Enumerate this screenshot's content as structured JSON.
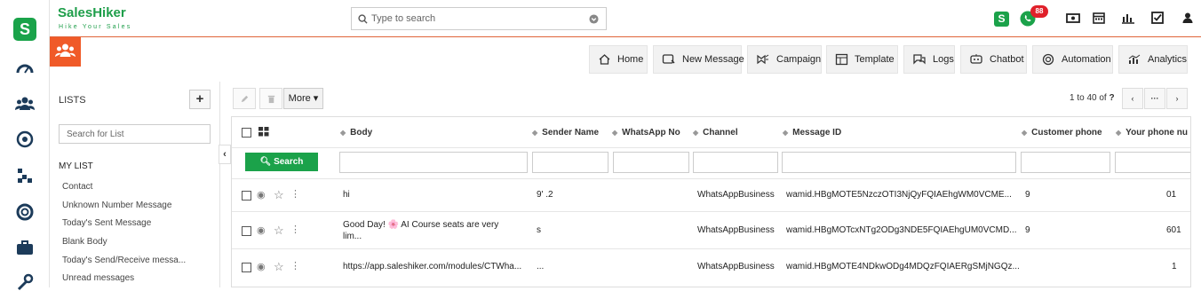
{
  "app": {
    "brand_name": "SalesHiker",
    "tagline": "Hike Your Sales",
    "whatsapp_badge": "88"
  },
  "search": {
    "placeholder": "Type to search"
  },
  "nav": [
    {
      "label": "Home",
      "icon": "home-icon"
    },
    {
      "label": "New Message",
      "icon": "new-message-icon"
    },
    {
      "label": "Campaign",
      "icon": "campaign-icon"
    },
    {
      "label": "Template",
      "icon": "template-icon"
    },
    {
      "label": "Logs",
      "icon": "logs-icon"
    },
    {
      "label": "Chatbot",
      "icon": "chatbot-icon"
    },
    {
      "label": "Automation",
      "icon": "automation-icon"
    },
    {
      "label": "Analytics",
      "icon": "analytics-icon"
    }
  ],
  "lists": {
    "title": "LISTS",
    "search_placeholder": "Search for List",
    "section": "MY LIST",
    "items": [
      "Contact",
      "Unknown Number Message",
      "Today's Sent Message",
      "Blank Body",
      "Today's Send/Receive messa...",
      "Unread messages"
    ]
  },
  "toolbar": {
    "more_label": "More ▾"
  },
  "pagination": {
    "range": "1 to 40",
    "of_label": "of",
    "total": "?"
  },
  "grid": {
    "search_button": "Search",
    "columns": [
      "Body",
      "Sender Name",
      "WhatsApp No",
      "Channel",
      "Message ID",
      "Customer phone",
      "Your phone nu"
    ],
    "rows": [
      {
        "body": "hi",
        "sender": "9'  .2",
        "whatsapp": "",
        "channel": "WhatsAppBusiness",
        "message_id": "wamid.HBgMOTE5NzczOTI3NjQyFQIAEhgWM0VCME...",
        "customer_phone": "9",
        "your_phone": "01"
      },
      {
        "body": "Good Day! 🌸 AI Course seats are very lim...",
        "sender": "s",
        "whatsapp": "",
        "channel": "WhatsAppBusiness",
        "message_id": "wamid.HBgMOTcxNTg2ODg3NDE5FQIAEhgUM0VCMD...",
        "customer_phone": "9",
        "your_phone": "601"
      },
      {
        "body": "https://app.saleshiker.com/modules/CTWha...",
        "sender": "...",
        "whatsapp": "",
        "channel": "WhatsAppBusiness",
        "message_id": "wamid.HBgMOTE4NDkwODg4MDQzFQIAERgSMjNGQz...",
        "customer_phone": "",
        "your_phone": "1"
      }
    ]
  },
  "colors": {
    "brand_green": "#1ba24a",
    "accent_orange": "#f05a28",
    "badge_red": "#e0202a"
  }
}
